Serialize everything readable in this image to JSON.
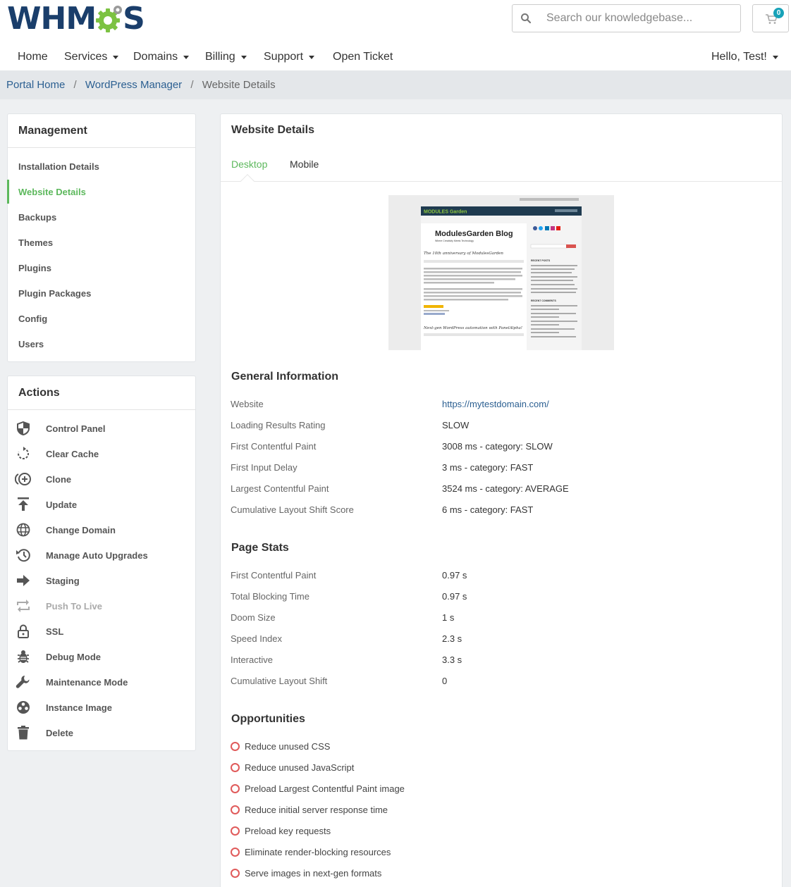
{
  "header": {
    "logo_text_left": "WHM",
    "logo_text_right": "S",
    "search_placeholder": "Search our knowledgebase...",
    "cart_count": "0"
  },
  "nav": {
    "home": "Home",
    "services": "Services",
    "domains": "Domains",
    "billing": "Billing",
    "support": "Support",
    "open_ticket": "Open Ticket",
    "user": "Hello, Test!"
  },
  "breadcrumb": {
    "items": [
      "Portal Home",
      "WordPress Manager"
    ],
    "current": "Website Details",
    "separator": "/"
  },
  "management": {
    "title": "Management",
    "items": [
      "Installation Details",
      "Website Details",
      "Backups",
      "Themes",
      "Plugins",
      "Plugin Packages",
      "Config",
      "Users"
    ]
  },
  "actions": {
    "title": "Actions",
    "items": [
      {
        "label": "Control Panel",
        "icon": "shield-icon"
      },
      {
        "label": "Clear Cache",
        "icon": "refresh-icon"
      },
      {
        "label": "Clone",
        "icon": "clone-plus-icon"
      },
      {
        "label": "Update",
        "icon": "upload-icon"
      },
      {
        "label": "Change Domain",
        "icon": "globe-icon"
      },
      {
        "label": "Manage Auto Upgrades",
        "icon": "history-icon"
      },
      {
        "label": "Staging",
        "icon": "arrow-right-icon"
      },
      {
        "label": "Push To Live",
        "icon": "repeat-icon"
      },
      {
        "label": "SSL",
        "icon": "lock-icon"
      },
      {
        "label": "Debug Mode",
        "icon": "bug-icon"
      },
      {
        "label": "Maintenance Mode",
        "icon": "wrench-icon"
      },
      {
        "label": "Instance Image",
        "icon": "image-icon"
      },
      {
        "label": "Delete",
        "icon": "trash-icon"
      }
    ]
  },
  "main": {
    "title": "Website Details",
    "tabs": [
      "Desktop",
      "Mobile"
    ],
    "preview": {
      "brand": "MODULES Garden",
      "blog_title": "ModulesGarden Blog",
      "blog_tagline": "Where Creativity Meets Technology",
      "post_title": "The 10th anniversary of ModulesGarden",
      "post_title_2": "Next-gen WordPress automation with PanelAlpha!",
      "sidebar_heading_1": "RECENT POSTS",
      "sidebar_heading_2": "RECENT COMMENTS"
    },
    "general": {
      "title": "General Information",
      "rows": [
        {
          "label": "Website",
          "value": "https://mytestdomain.com/"
        },
        {
          "label": "Loading Results Rating",
          "value": "SLOW"
        },
        {
          "label": "First Contentful Paint",
          "value": "3008 ms - category: SLOW"
        },
        {
          "label": "First Input Delay",
          "value": "3 ms - category: FAST"
        },
        {
          "label": "Largest Contentful Paint",
          "value": "3524 ms - category: AVERAGE"
        },
        {
          "label": "Cumulative Layout Shift Score",
          "value": "6 ms - category: FAST"
        }
      ]
    },
    "stats": {
      "title": "Page Stats",
      "rows": [
        {
          "label": "First Contentful Paint",
          "value": "0.97 s"
        },
        {
          "label": "Total Blocking Time",
          "value": "0.97 s"
        },
        {
          "label": "Doom Size",
          "value": "1 s"
        },
        {
          "label": "Speed Index",
          "value": "2.3 s"
        },
        {
          "label": "Interactive",
          "value": "3.3 s"
        },
        {
          "label": "Cumulative Layout Shift",
          "value": "0"
        }
      ]
    },
    "opportunities": {
      "title": "Opportunities",
      "items": [
        "Reduce unused CSS",
        "Reduce unused JavaScript",
        "Preload Largest Contentful Paint image",
        "Reduce initial server response time",
        "Preload key requests",
        "Eliminate render-blocking resources",
        "Serve images in next-gen formats"
      ]
    }
  },
  "colors": {
    "accent_green": "#5cb85c",
    "link_blue": "#2b5f91",
    "logo_navy": "#1a3e6b",
    "gear_green": "#7cc242",
    "badge_teal": "#17a2b8",
    "opportunity_red": "#e05a5a"
  }
}
